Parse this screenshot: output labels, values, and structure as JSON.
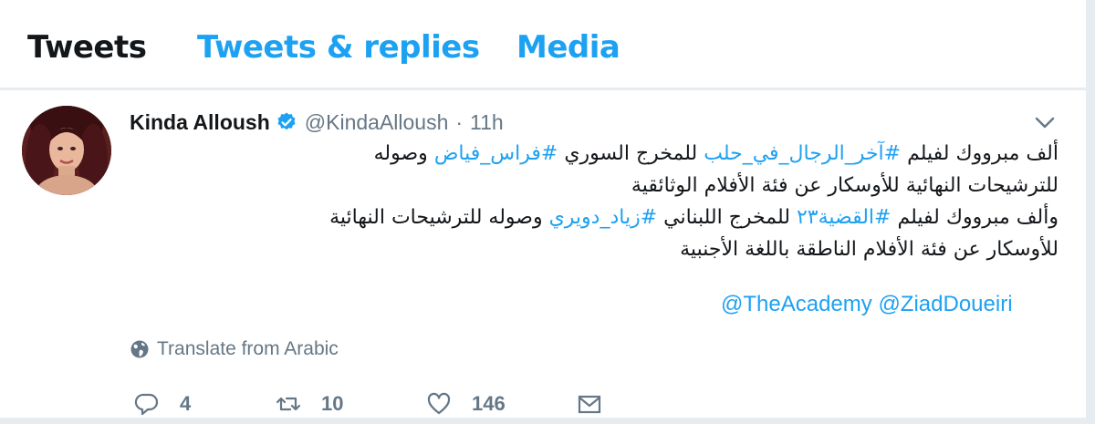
{
  "tabs": [
    {
      "label": "Tweets"
    },
    {
      "label": "Tweets & replies"
    },
    {
      "label": "Media"
    }
  ],
  "tweet": {
    "author": {
      "name": "Kinda Alloush",
      "handle": "@KindaAlloush",
      "verified": true
    },
    "separator": "·",
    "time": "11h",
    "text": {
      "line1": {
        "pre": "ألف مبرووك لفيلم ",
        "hashtag1": "#آخر_الرجال_في_حلب",
        "mid": " للمخرج السوري ",
        "hashtag2": "#فراس_فياض",
        "post": " وصوله"
      },
      "line2": "للترشيحات النهائية للأوسكار عن فئة الأفلام الوثائقية",
      "line3": {
        "pre": "وألف مبرووك لفيلم ",
        "hashtag1": "#القضية٢٣",
        "mid": " للمخرج اللبناني ",
        "hashtag2": "#زياد_دويري",
        "post": " وصوله للترشيحات النهائية"
      },
      "line4": "للأوسكار عن فئة الأفلام الناطقة باللغة الأجنبية"
    },
    "mentions": [
      "@TheAcademy",
      "@ZiadDoueiri"
    ],
    "translate_label": "Translate from Arabic",
    "actions": {
      "reply_count": "4",
      "retweet_count": "10",
      "like_count": "146"
    }
  },
  "colors": {
    "accent": "#1da1f2",
    "text": "#14171a",
    "muted": "#657786",
    "divider": "#e6ecf0"
  },
  "icons": {
    "verified": "verified-badge-icon",
    "caret": "chevron-down-icon",
    "globe": "globe-icon",
    "reply": "reply-icon",
    "retweet": "retweet-icon",
    "like": "heart-icon",
    "message": "envelope-icon"
  }
}
